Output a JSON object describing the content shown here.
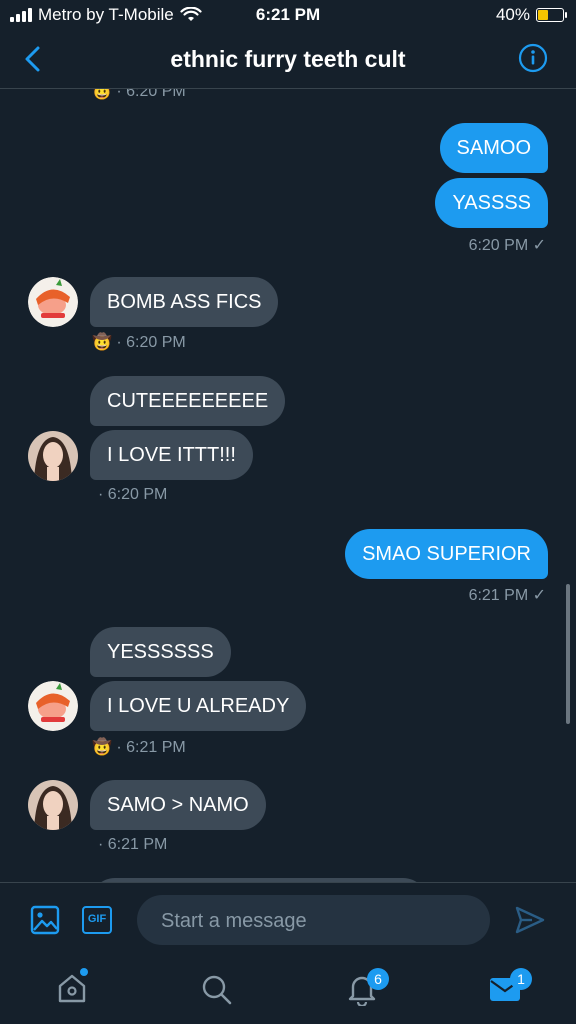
{
  "status_bar": {
    "carrier": "Metro by T-Mobile",
    "time": "6:21 PM",
    "battery": "40%"
  },
  "header": {
    "title": "ethnic furry teeth cult"
  },
  "messages": {
    "m0_meta": "· 6:20 PM",
    "m1": "SAMOO",
    "m2": "YASSSS",
    "m2_meta": "6:20 PM ✓",
    "m3": "BOMB ASS FICS",
    "m3_meta": "· 6:20 PM",
    "m4": "CUTEEEEEEEEE",
    "m5": "I LOVE ITTT!!!",
    "m5_meta": "· 6:20 PM",
    "m6": "SMAO SUPERIOR",
    "m6_meta": "6:21 PM ✓",
    "m7": "YESSSSSS",
    "m8": "I LOVE U ALREADY",
    "m8_meta": "· 6:21 PM",
    "m9": "SAMO > NAMO",
    "m9_meta": "· 6:21 PM"
  },
  "composer": {
    "placeholder": "Start a message",
    "gif_label": "GIF"
  },
  "tabbar": {
    "notifications_count": "6",
    "messages_count": "1"
  },
  "colors": {
    "background": "#15202b",
    "accent": "#1d9bf0",
    "incoming_bubble": "#3d4a57",
    "muted": "#8899a6"
  }
}
